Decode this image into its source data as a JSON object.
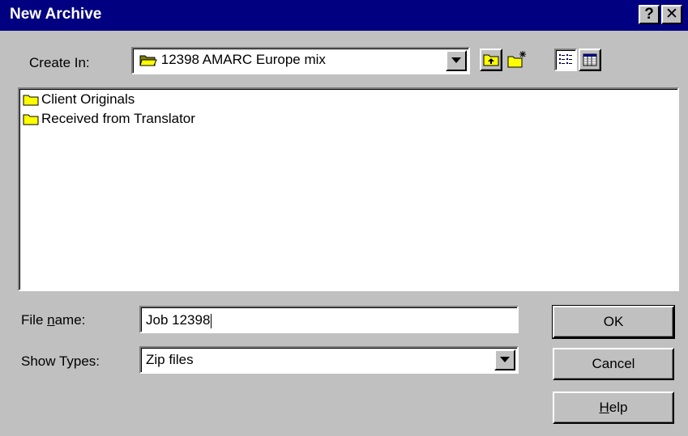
{
  "window": {
    "title": "New Archive",
    "help_button": "?",
    "close_button": "✕"
  },
  "create_in": {
    "label": "Create In:",
    "value": "12398 AMARC Europe mix"
  },
  "toolbar": {
    "up_one_level": "up-folder-icon",
    "new_folder": "new-folder-icon",
    "list_view": "list-view-icon",
    "details_view": "details-view-icon"
  },
  "file_list": {
    "items": [
      {
        "label": "Client Originals",
        "icon": "folder-icon"
      },
      {
        "label": "Received from Translator",
        "icon": "folder-icon"
      }
    ]
  },
  "file_name": {
    "label_pre": "File ",
    "label_ul": "n",
    "label_post": "ame:",
    "value": "Job 12398"
  },
  "show_types": {
    "label": "Show Types:",
    "value": "Zip files"
  },
  "buttons": {
    "ok": "OK",
    "cancel": "Cancel",
    "help_ul": "H",
    "help_rest": "elp"
  },
  "colors": {
    "titlebar": "#000080",
    "face": "#c0c0c0",
    "folder": "#ffff00"
  }
}
